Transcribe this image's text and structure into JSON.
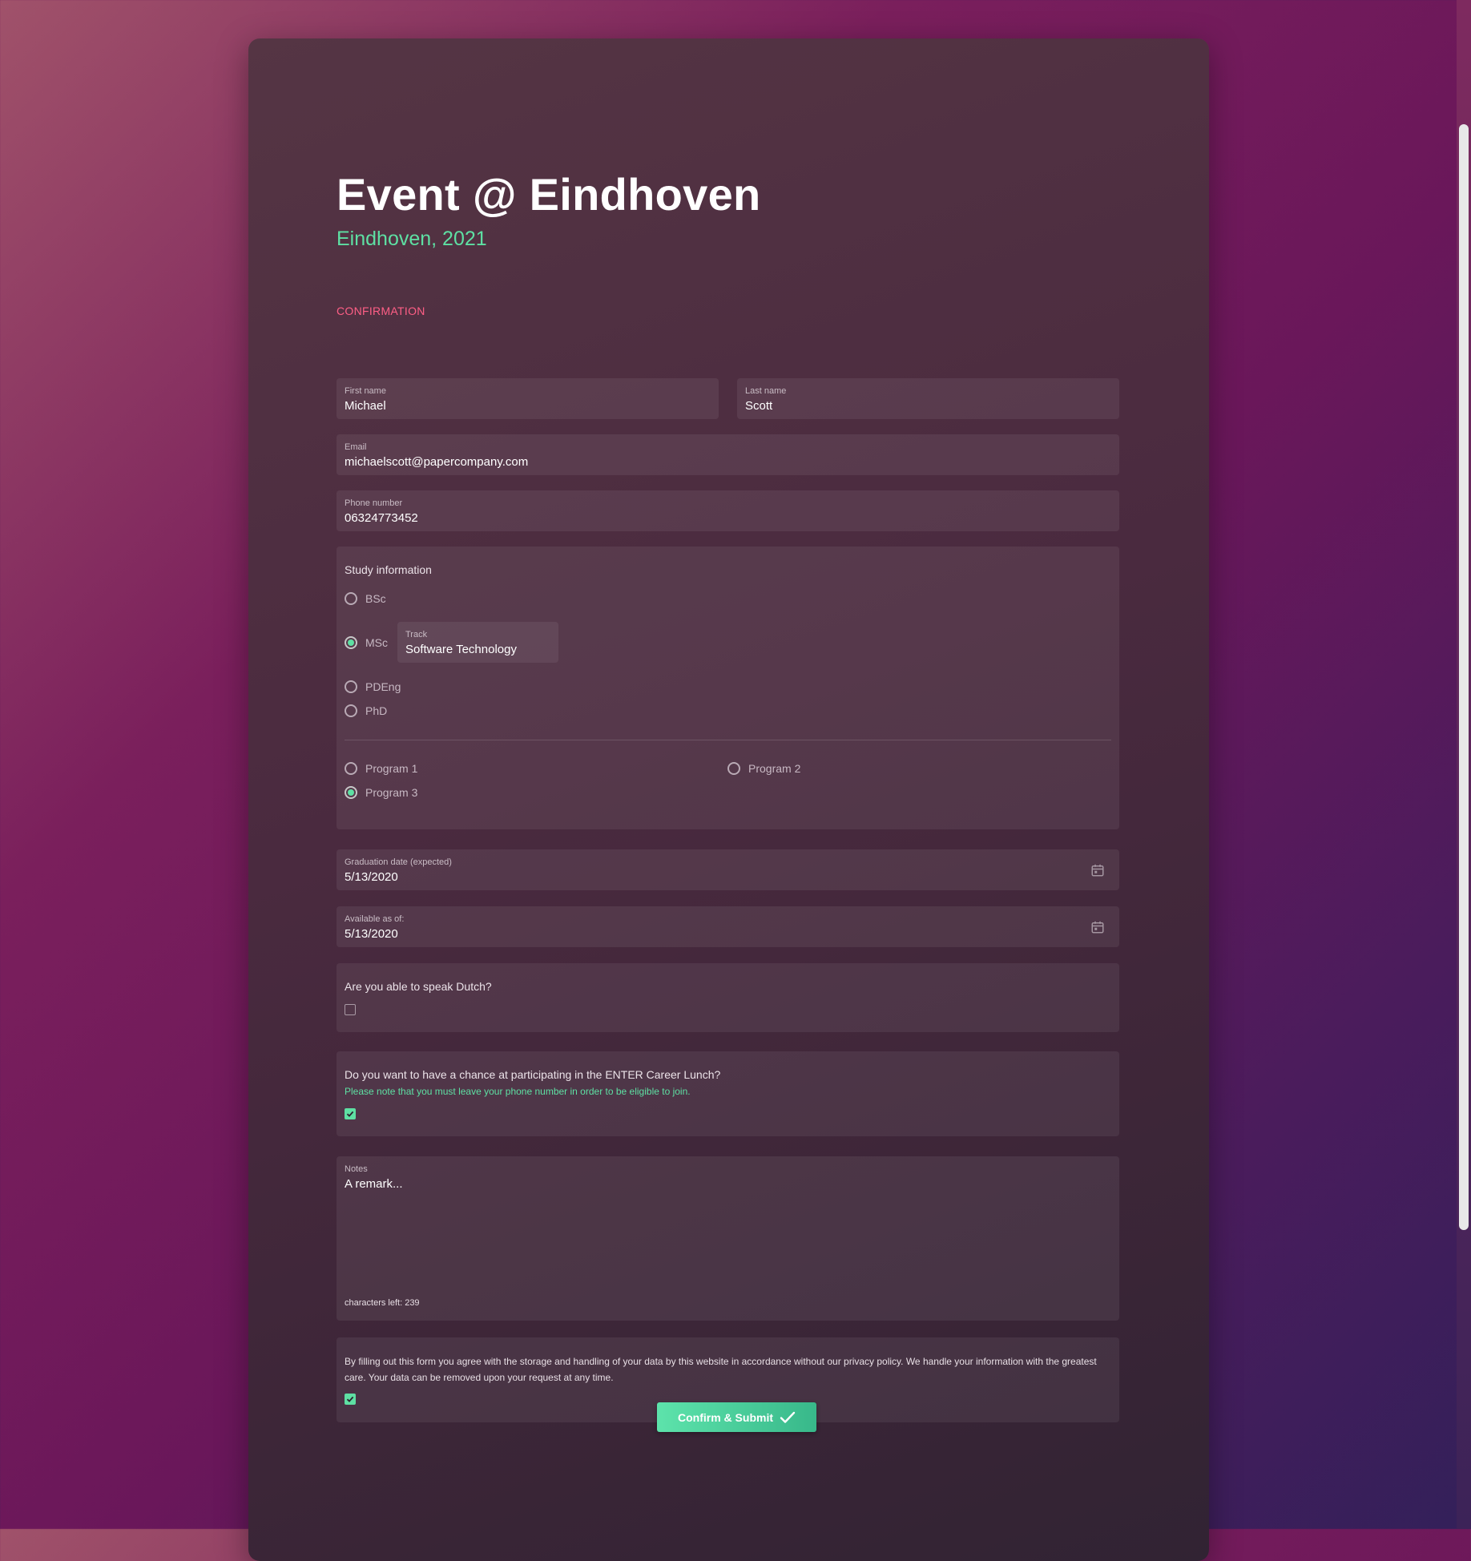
{
  "event": {
    "title": "Event @ Eindhoven",
    "subtitle": "Eindhoven, 2021",
    "section": "CONFIRMATION"
  },
  "form": {
    "first_name": {
      "label": "First name",
      "value": "Michael"
    },
    "last_name": {
      "label": "Last name",
      "value": "Scott"
    },
    "email": {
      "label": "Email",
      "value": "michaelscott@papercompany.com"
    },
    "phone": {
      "label": "Phone number",
      "value": "06324773452"
    },
    "study": {
      "title": "Study information",
      "degrees": [
        {
          "label": "BSc",
          "checked": false
        },
        {
          "label": "MSc",
          "checked": true
        },
        {
          "label": "PDEng",
          "checked": false
        },
        {
          "label": "PhD",
          "checked": false
        }
      ],
      "track": {
        "label": "Track",
        "value": "Software Technology"
      },
      "programs": [
        {
          "label": "Program 1",
          "checked": false
        },
        {
          "label": "Program 2",
          "checked": false
        },
        {
          "label": "Program 3",
          "checked": true
        }
      ]
    },
    "graduation": {
      "label": "Graduation date (expected)",
      "value": "5/13/2020"
    },
    "available": {
      "label": "Available as of:",
      "value": "5/13/2020"
    },
    "dutch": {
      "question": "Are you able to speak Dutch?",
      "checked": false
    },
    "lunch": {
      "question": "Do you want to have a chance at participating in the ENTER Career Lunch?",
      "note": "Please note that you must leave your phone number in order to be eligible to join.",
      "checked": true
    },
    "notes": {
      "label": "Notes",
      "value": "A remark...",
      "chars_left": "characters left: 239"
    },
    "consent": {
      "text": "By filling out this form you agree with the storage and handling of your data by this website in accordance without our privacy policy. We handle your information with the greatest care. Your data can be removed upon your request at any time.",
      "checked": true
    },
    "submit_label": "Confirm & Submit"
  },
  "colors": {
    "accent_green": "#5ee0a3",
    "section_pink": "#ff5f86"
  },
  "icons": {
    "date": "calendar-icon",
    "submit": "checkmark-icon"
  }
}
